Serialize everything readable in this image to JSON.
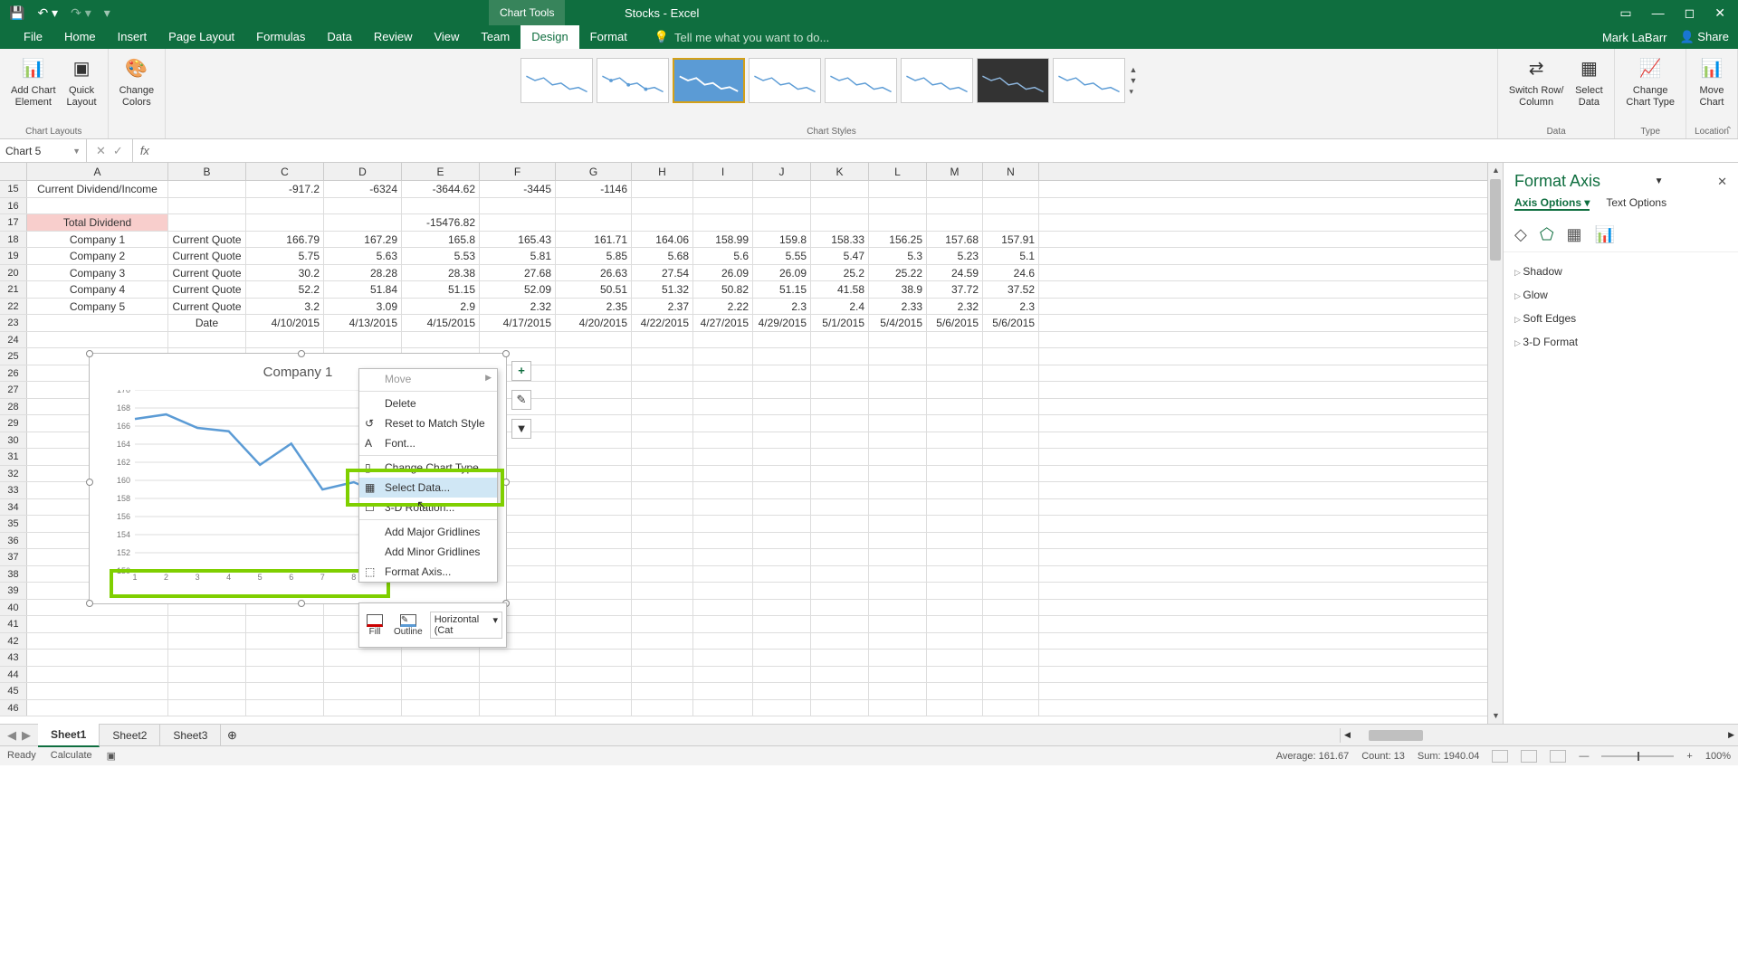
{
  "app": {
    "title": "Stocks - Excel",
    "chart_tools": "Chart Tools",
    "user": "Mark LaBarr",
    "share": "Share"
  },
  "tabs": [
    "File",
    "Home",
    "Insert",
    "Page Layout",
    "Formulas",
    "Data",
    "Review",
    "View",
    "Team",
    "Design",
    "Format"
  ],
  "tell_me": "Tell me what you want to do...",
  "ribbon": {
    "add_chart_element": "Add Chart\nElement",
    "quick_layout": "Quick\nLayout",
    "change_colors": "Change\nColors",
    "switch": "Switch Row/\nColumn",
    "select_data": "Select\nData",
    "change_type": "Change\nChart Type",
    "move_chart": "Move\nChart",
    "groups": {
      "layouts": "Chart Layouts",
      "styles": "Chart Styles",
      "data": "Data",
      "type": "Type",
      "location": "Location"
    }
  },
  "name_box": "Chart 5",
  "columns": [
    "A",
    "B",
    "C",
    "D",
    "E",
    "F",
    "G",
    "H",
    "I",
    "J",
    "K",
    "L",
    "M",
    "N"
  ],
  "visible_rows": [
    15,
    16,
    17,
    18,
    19,
    20,
    21,
    22,
    23,
    24,
    25,
    26,
    27,
    28,
    29,
    30,
    31,
    32,
    33,
    34,
    35,
    36,
    37,
    38,
    39,
    40,
    41,
    42,
    43,
    44,
    45,
    46
  ],
  "cells": {
    "15": {
      "A": "Current Dividend/Income",
      "C": "-917.2",
      "D": "-6324",
      "E": "-3644.62",
      "F": "-3445",
      "G": "-1146"
    },
    "17": {
      "A": "Total Dividend",
      "E": "-15476.82"
    },
    "18": {
      "A": "Company 1",
      "B": "Current Quote",
      "C": "166.79",
      "D": "167.29",
      "E": "165.8",
      "F": "165.43",
      "G": "161.71",
      "H": "164.06",
      "I": "158.99",
      "J": "159.8",
      "K": "158.33",
      "L": "156.25",
      "M": "157.68",
      "N": "157.91"
    },
    "19": {
      "A": "Company 2",
      "B": "Current Quote",
      "C": "5.75",
      "D": "5.63",
      "E": "5.53",
      "F": "5.81",
      "G": "5.85",
      "H": "5.68",
      "I": "5.6",
      "J": "5.55",
      "K": "5.47",
      "L": "5.3",
      "M": "5.23",
      "N": "5.1"
    },
    "20": {
      "A": "Company 3",
      "B": "Current Quote",
      "C": "30.2",
      "D": "28.28",
      "E": "28.38",
      "F": "27.68",
      "G": "26.63",
      "H": "27.54",
      "I": "26.09",
      "J": "26.09",
      "K": "25.2",
      "L": "25.22",
      "M": "24.59",
      "N": "24.6"
    },
    "21": {
      "A": "Company 4",
      "B": "Current Quote",
      "C": "52.2",
      "D": "51.84",
      "E": "51.15",
      "F": "52.09",
      "G": "50.51",
      "H": "51.32",
      "I": "50.82",
      "J": "51.15",
      "K": "41.58",
      "L": "38.9",
      "M": "37.72",
      "N": "37.52"
    },
    "22": {
      "A": "Company 5",
      "B": "Current Quote",
      "C": "3.2",
      "D": "3.09",
      "E": "2.9",
      "F": "2.32",
      "G": "2.35",
      "H": "2.37",
      "I": "2.22",
      "J": "2.3",
      "K": "2.4",
      "L": "2.33",
      "M": "2.32",
      "N": "2.3"
    },
    "23": {
      "B": "Date",
      "C": "4/10/2015",
      "D": "4/13/2015",
      "E": "4/15/2015",
      "F": "4/17/2015",
      "G": "4/20/2015",
      "H": "4/22/2015",
      "I": "4/27/2015",
      "J": "4/29/2015",
      "K": "5/1/2015",
      "L": "5/4/2015",
      "M": "5/6/2015",
      "N": "5/6/2015"
    }
  },
  "pink_cells": [
    "17-A"
  ],
  "chart": {
    "title": "Company 1",
    "side_btns": [
      "+",
      "✎",
      "▼"
    ]
  },
  "chart_data": {
    "type": "line",
    "title": "Company 1",
    "x": [
      1,
      2,
      3,
      4,
      5,
      6,
      7,
      8,
      9,
      10,
      11,
      12
    ],
    "y": [
      166.79,
      167.29,
      165.8,
      165.43,
      161.71,
      164.06,
      158.99,
      159.8,
      158.33,
      156.25,
      157.68,
      157.91
    ],
    "ylabel": "",
    "xlabel": "",
    "ylim": [
      150,
      170
    ],
    "yticks": [
      150,
      152,
      154,
      156,
      158,
      160,
      162,
      164,
      166,
      168,
      170
    ]
  },
  "context_menu": {
    "items": [
      {
        "label": "Move",
        "disabled": true,
        "sub": true
      },
      {
        "label": "Delete"
      },
      {
        "label": "Reset to Match Style",
        "icon": "↺"
      },
      {
        "label": "Font...",
        "icon": "A"
      },
      {
        "label": "Change Chart Type...",
        "icon": "▯"
      },
      {
        "label": "Select Data...",
        "icon": "▦",
        "hover": true
      },
      {
        "label": "3-D Rotation...",
        "icon": "☐"
      },
      {
        "label": "Add Major Gridlines"
      },
      {
        "label": "Add Minor Gridlines"
      },
      {
        "label": "Format Axis...",
        "icon": "⬚"
      }
    ],
    "mini": {
      "fill": "Fill",
      "outline": "Outline",
      "select": "Horizontal (Cat"
    }
  },
  "task_pane": {
    "title": "Format Axis",
    "axis_options": "Axis Options",
    "text_options": "Text Options",
    "items": [
      "Shadow",
      "Glow",
      "Soft Edges",
      "3-D Format"
    ]
  },
  "sheets": [
    "Sheet1",
    "Sheet2",
    "Sheet3"
  ],
  "status": {
    "ready": "Ready",
    "calc": "Calculate",
    "avg": "Average: 161.67",
    "count": "Count: 13",
    "sum": "Sum: 1940.04",
    "zoom": "100%"
  }
}
